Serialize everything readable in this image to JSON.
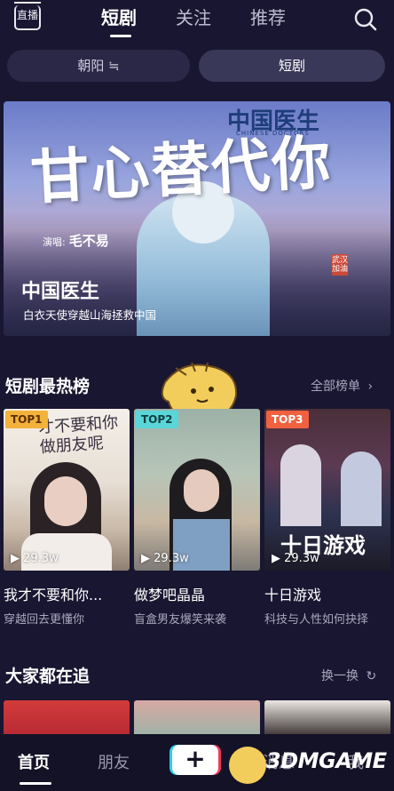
{
  "header": {
    "live_label": "直播",
    "tabs": [
      {
        "label": "短剧"
      },
      {
        "label": "关注"
      },
      {
        "label": "推荐"
      }
    ]
  },
  "filters": {
    "location": "朝阳 ≒",
    "category": "短剧"
  },
  "banner": {
    "brand": "中国医生",
    "brand_sub": "CHINESE DOCTORS",
    "calligraphy": "甘心替代你",
    "credit_prefix": "演唱:",
    "credit_name": "毛不易",
    "tag": "武汉加油",
    "title": "中国医生",
    "subtitle": "白衣天使穿越山海拯救中国"
  },
  "hot_section": {
    "title": "短剧最热榜",
    "link": "全部榜单"
  },
  "cards": [
    {
      "badge": "TOP1",
      "views": "29.3w",
      "title": "我才不要和你...",
      "subtitle": "穿越回去更懂你",
      "overlay": "才不要和你做朋友呢"
    },
    {
      "badge": "TOP2",
      "views": "29.3w",
      "title": "做梦吧晶晶",
      "subtitle": "盲盒男友爆笑来袭",
      "overlay": ""
    },
    {
      "badge": "TOP3",
      "views": "29.3w",
      "title": "十日游戏",
      "subtitle": "科技与人性如何抉择",
      "overlay": "十日游戏"
    }
  ],
  "follow_section": {
    "title": "大家都在追",
    "link": "换一换"
  },
  "bottom_nav": {
    "home": "首页",
    "friends": "朋友",
    "plus": "+",
    "messages": "消息",
    "me": "我"
  },
  "watermark": "3DMGAME",
  "colors": {
    "background": "#191631",
    "top1_badge": "#f3b23b",
    "top2_badge": "#5ad6d9",
    "top3_badge": "#f0613f"
  }
}
